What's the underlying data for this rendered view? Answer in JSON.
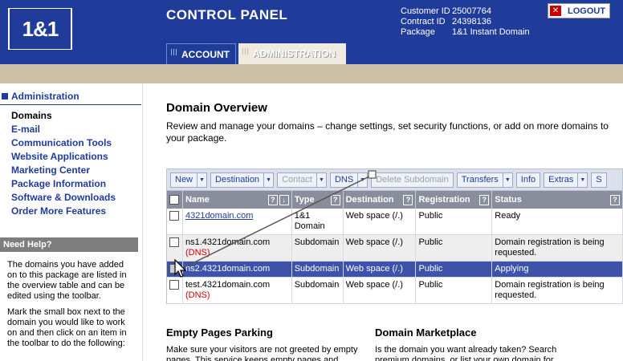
{
  "header": {
    "logo_text": "1&1",
    "title": "CONTROL PANEL",
    "customer": [
      {
        "key": "Customer ID",
        "value": "25007764"
      },
      {
        "key": "Contract ID",
        "value": "24398136"
      },
      {
        "key": "Package",
        "value": "1&1 Instant Domain"
      }
    ],
    "logout_label": "LOGOUT",
    "tabs": [
      {
        "label": "ACCOUNT"
      },
      {
        "label": "ADMINISTRATION"
      }
    ]
  },
  "sidebar": {
    "heading": "Administration",
    "items": [
      {
        "label": "Domains",
        "active": true
      },
      {
        "label": "E-mail"
      },
      {
        "label": "Communication Tools"
      },
      {
        "label": "Website Applications"
      },
      {
        "label": "Marketing Center"
      },
      {
        "label": "Package Information"
      },
      {
        "label": "Software & Downloads"
      },
      {
        "label": "Order More Features"
      }
    ],
    "help_heading": "Need Help?",
    "help_p1": "The domains you have added on to this package are listed in the overview table and can be edited using the toolbar.",
    "help_p2": "Mark the small box next to the domain you would like to work on and then click on an item in the toolbar to do the following:"
  },
  "main": {
    "title": "Domain Overview",
    "description": "Review and manage your domains – change settings, set security functions, or add on more domains to your package.",
    "toolbar": [
      {
        "label": "New",
        "dropdown": true
      },
      {
        "label": "Destination",
        "dropdown": true
      },
      {
        "label": "Contact",
        "dropdown": true,
        "disabled": true
      },
      {
        "label": "DNS",
        "dropdown": true
      },
      {
        "label": "Delete Subdomain",
        "disabled": true
      },
      {
        "label": "Transfers",
        "dropdown": true
      },
      {
        "label": "Info"
      },
      {
        "label": "Extras",
        "dropdown": true
      },
      {
        "label": "S"
      }
    ],
    "columns": [
      "Name",
      "Type",
      "Destination",
      "Registration",
      "Status"
    ],
    "rows": [
      {
        "name": "4321domain.com",
        "name_link": true,
        "dns": "",
        "type": "1&1 Domain",
        "destination": "Web space (/.)",
        "registration": "Public",
        "status": "Ready"
      },
      {
        "name": "ns1.4321domain.com",
        "dns": "(DNS)",
        "type": "Subdomain",
        "destination": "Web space (/.)",
        "registration": "Public",
        "status": "Domain registration is being requested."
      },
      {
        "name": "ns2.4321domain.com",
        "dns": "",
        "type": "Subdomain",
        "destination": "Web space (/.)",
        "registration": "Public",
        "status": "Applying",
        "selected": true
      },
      {
        "name": "test.4321domain.com",
        "dns": "(DNS)",
        "type": "Subdomain",
        "destination": "Web space (/.)",
        "registration": "Public",
        "status": "Domain registration is being requested."
      }
    ],
    "sections": [
      {
        "title": "Empty Pages Parking",
        "text": "Make sure your visitors are not greeted by empty pages. This service keeps empty pages and"
      },
      {
        "title": "Domain Marketplace",
        "text": "Is the domain you want already taken? Search premium domains, or list your own domain for"
      }
    ]
  }
}
